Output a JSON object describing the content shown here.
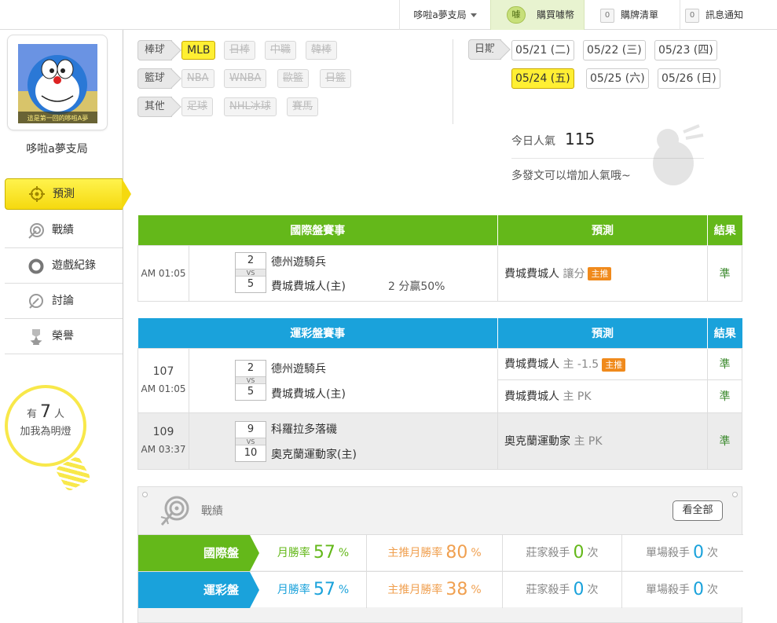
{
  "topbar": {
    "user_menu": "哆啦a夢支局",
    "buy_coin_icon_text": "噱",
    "buy_label": "購買噱幣",
    "cart_count": "0",
    "cart_label": "購牌清單",
    "notify_count": "0",
    "notify_label": "訊息通知"
  },
  "profile": {
    "name": "哆啦a夢支局",
    "avatar_caption": "這是第一回的哆啦A夢"
  },
  "nav": [
    {
      "label": "預測",
      "icon": "target-icon",
      "active": true
    },
    {
      "label": "戰績",
      "icon": "record-target-icon",
      "active": false
    },
    {
      "label": "遊戲紀錄",
      "icon": "ring-icon",
      "active": false
    },
    {
      "label": "討論",
      "icon": "chat-pen-icon",
      "active": false
    },
    {
      "label": "榮譽",
      "icon": "medal-icon",
      "active": false
    }
  ],
  "bulb": {
    "prefix": "有",
    "count": "7",
    "suffix": "人",
    "line2": "加我為明燈"
  },
  "filters": {
    "baseball": {
      "label": "棒球",
      "items": [
        "MLB",
        "日棒",
        "中職",
        "韓棒"
      ]
    },
    "basketball": {
      "label": "籃球",
      "items": [
        "NBA",
        "WNBA",
        "歐籃",
        "日籃"
      ]
    },
    "other": {
      "label": "其他",
      "items": [
        "足球",
        "NHL冰球",
        "賽馬"
      ]
    }
  },
  "dates": {
    "label": "日期",
    "items": [
      "05/21 (二)",
      "05/22 (三)",
      "05/23 (四)",
      "05/24 (五)",
      "05/25 (六)",
      "05/26 (日)"
    ],
    "selected": "05/24 (五)"
  },
  "popularity": {
    "label": "今日人氣",
    "value": "115",
    "hint": "多發文可以增加人氣哦~"
  },
  "intl_table": {
    "headers": [
      "國際盤賽事",
      "預測",
      "結果"
    ],
    "rows": [
      {
        "no": "",
        "time": "AM 01:05",
        "away": "德州遊騎兵",
        "away_score": "2",
        "home": "費城費城人(主)",
        "home_score": "5",
        "odds": "2 分贏50%",
        "picks": [
          {
            "team": "費城費城人",
            "type": "讓分",
            "badge": "主推",
            "result": "準"
          }
        ]
      }
    ]
  },
  "lottery_table": {
    "headers": [
      "運彩盤賽事",
      "預測",
      "結果"
    ],
    "rows": [
      {
        "no": "107",
        "time": "AM 01:05",
        "away": "德州遊騎兵",
        "away_score": "2",
        "home": "費城費城人(主)",
        "home_score": "5",
        "picks": [
          {
            "team": "費城費城人",
            "type": "主 -1.5",
            "badge": "主推",
            "result": "準"
          },
          {
            "team": "費城費城人",
            "type": "主 PK",
            "badge": "",
            "result": "準"
          }
        ]
      },
      {
        "no": "109",
        "time": "AM 03:37",
        "away": "科羅拉多落磯",
        "away_score": "9",
        "home": "奧克蘭運動家(主)",
        "home_score": "10",
        "picks": [
          {
            "team": "奧克蘭運動家",
            "type": "主 PK",
            "badge": "",
            "result": "準"
          }
        ]
      }
    ]
  },
  "vs_label": "VS",
  "record": {
    "title": "戰績",
    "see_all": "看全部",
    "rows": [
      {
        "name": "國際盤",
        "monthly_label": "月勝率",
        "monthly": "57",
        "main_label": "主推月勝率",
        "main": "80",
        "pct": "%",
        "house_label": "莊家殺手",
        "house": "0",
        "single_label": "單場殺手",
        "single": "0",
        "unit": "次"
      },
      {
        "name": "運彩盤",
        "monthly_label": "月勝率",
        "monthly": "57",
        "main_label": "主推月勝率",
        "main": "38",
        "pct": "%",
        "house_label": "莊家殺手",
        "house": "0",
        "single_label": "單場殺手",
        "single": "0",
        "unit": "次"
      }
    ]
  },
  "colors": {
    "green": "#64b81a",
    "blue": "#1aa2db",
    "yellow": "#ffef33",
    "orange": "#f08a1c"
  }
}
